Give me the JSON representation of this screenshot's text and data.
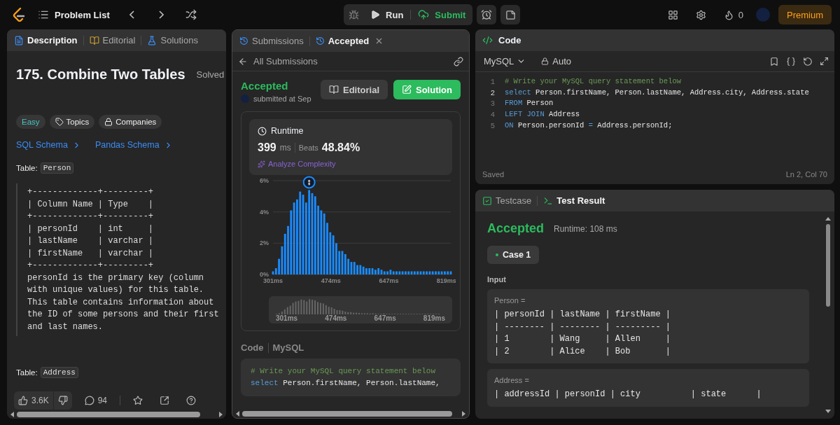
{
  "top_bar": {
    "problem_list": "Problem List",
    "run": "Run",
    "submit": "Submit",
    "streak": "0",
    "premium": "Premium"
  },
  "description_panel": {
    "tabs": [
      {
        "label": "Description",
        "kind": "description",
        "selected": true
      },
      {
        "label": "Editorial",
        "kind": "editorial",
        "selected": false
      },
      {
        "label": "Solutions",
        "kind": "solutions",
        "selected": false
      }
    ],
    "title": "175. Combine Two Tables",
    "status": "Solved",
    "tags": [
      {
        "label": "Easy",
        "kind": "difficulty"
      },
      {
        "label": "Topics",
        "kind": "topics"
      },
      {
        "label": "Companies",
        "kind": "companies"
      }
    ],
    "links": [
      "SQL Schema",
      "Pandas Schema"
    ],
    "tables": [
      {
        "prefix": "Table:",
        "name": "Person",
        "schema": "+-------------+---------+\n| Column Name | Type    |\n+-------------+---------+\n| personId    | int     |\n| lastName    | varchar |\n| firstName   | varchar |\n+-------------+---------+\npersonId is the primary key (column\nwith unique values) for this table.\nThis table contains information about\nthe ID of some persons and their first\nand last names."
      },
      {
        "prefix": "Table:",
        "name": "Address"
      }
    ],
    "footer": {
      "likes": "3.6K",
      "comments": "94"
    }
  },
  "submission_panel": {
    "tabs": [
      {
        "label": "Submissions",
        "selected": false,
        "closable": false
      },
      {
        "label": "Accepted",
        "selected": true,
        "closable": true
      }
    ],
    "back": "All Submissions",
    "status": "Accepted",
    "submitted": "submitted at Sep",
    "buttons": [
      {
        "label": "Editorial",
        "kind": "secondary"
      },
      {
        "label": "Solution",
        "kind": "primary"
      }
    ],
    "runtime": {
      "title": "Runtime",
      "value": "399",
      "unit": "ms",
      "beats_label": "Beats",
      "beats": "48.84%",
      "analyze": "Analyze Complexity"
    },
    "chart_data": {
      "type": "bar",
      "xlim": [
        301,
        832
      ],
      "ylim": [
        0,
        6
      ],
      "x": [
        301,
        310,
        319,
        328,
        337,
        346,
        355,
        364,
        373,
        382,
        391,
        400,
        409,
        418,
        427,
        436,
        445,
        454,
        463,
        472,
        481,
        490,
        499,
        508,
        517,
        526,
        535,
        544,
        553,
        562,
        571,
        580,
        589,
        598,
        607,
        616,
        625,
        634,
        643,
        652,
        661,
        670,
        679,
        688,
        697,
        706,
        715,
        724,
        733,
        742,
        751,
        760,
        769,
        778,
        787,
        796,
        805,
        814,
        823,
        832
      ],
      "series": [
        {
          "color": "#1a8cff",
          "values": [
            0.2,
            0.4,
            1.0,
            1.8,
            2.6,
            3.1,
            4.1,
            4.6,
            4.8,
            5.3,
            5.1,
            4.6,
            5.4,
            5.2,
            5.0,
            4.4,
            4.1,
            3.9,
            3.3,
            2.7,
            2.5,
            2.0,
            1.5,
            1.5,
            1.3,
            1.0,
            0.8,
            0.8,
            0.6,
            0.6,
            0.5,
            0.4,
            0.4,
            0.4,
            0.3,
            0.4,
            0.3,
            0.2,
            0.2,
            0.3,
            0.2,
            0.2,
            0.2,
            0.2,
            0.2,
            0.2,
            0.2,
            0.2,
            0.2,
            0.2,
            0.2,
            0.2,
            0.2,
            0.2,
            0.2,
            0.2,
            0.2,
            0.2,
            0.2,
            0.2
          ]
        }
      ],
      "yticks": [
        {
          "value": 0,
          "label": "0%"
        },
        {
          "value": 2,
          "label": "2%"
        },
        {
          "value": 4,
          "label": "4%"
        },
        {
          "value": 6,
          "label": "6%"
        }
      ],
      "xticks": [
        {
          "value": 301,
          "label": "301ms"
        },
        {
          "value": 474,
          "label": "474ms"
        },
        {
          "value": 647,
          "label": "647ms"
        },
        {
          "value": 819,
          "label": "819ms"
        }
      ]
    },
    "overview_labels": [
      "301ms",
      "474ms",
      "647ms",
      "819ms"
    ],
    "code_label": "Code",
    "language": "MySQL",
    "code_lines": [
      [
        {
          "text": "# Write your MySQL query statement below",
          "kind": "comment"
        }
      ],
      [
        {
          "text": "select",
          "kind": "keyword"
        },
        {
          "text": " Person.firstName, Person.lastName,",
          "kind": "plain"
        }
      ]
    ]
  },
  "code_panel": {
    "title": "Code",
    "language": "MySQL",
    "mode": "Auto",
    "lines": [
      {
        "number": "1",
        "active": false,
        "tokens": [
          {
            "text": "# Write your MySQL query statement below",
            "kind": "comment"
          }
        ]
      },
      {
        "number": "2",
        "active": true,
        "tokens": [
          {
            "text": "select",
            "kind": "keyword"
          },
          {
            "text": " Person.firstName, Person.lastName, Address.city, Address.state",
            "kind": "plain"
          }
        ]
      },
      {
        "number": "3",
        "active": false,
        "tokens": [
          {
            "text": "FROM",
            "kind": "keyword"
          },
          {
            "text": " Person",
            "kind": "plain"
          }
        ]
      },
      {
        "number": "4",
        "active": false,
        "tokens": [
          {
            "text": "LEFT JOIN",
            "kind": "keyword"
          },
          {
            "text": " Address",
            "kind": "plain"
          }
        ]
      },
      {
        "number": "5",
        "active": false,
        "tokens": [
          {
            "text": "ON",
            "kind": "keyword"
          },
          {
            "text": " Person.personId ",
            "kind": "plain"
          },
          {
            "text": "=",
            "kind": "operator"
          },
          {
            "text": " Address.personId;",
            "kind": "plain"
          }
        ]
      }
    ],
    "saved": "Saved",
    "cursor": "Ln 2, Col 70"
  },
  "test_panel": {
    "tabs": [
      {
        "label": "Testcase",
        "kind": "testcase",
        "selected": false
      },
      {
        "label": "Test Result",
        "kind": "result",
        "selected": true
      }
    ],
    "status": "Accepted",
    "runtime": "Runtime: 108 ms",
    "cases": [
      {
        "label": "Case 1",
        "selected": true,
        "passed": true
      }
    ],
    "input_label": "Input",
    "inputs": [
      {
        "name": "Person =",
        "lines": [
          "| personId | lastName | firstName |",
          "| -------- | -------- | --------- |",
          "| 1        | Wang     | Allen     |",
          "| 2        | Alice    | Bob       |"
        ]
      },
      {
        "name": "Address =",
        "lines": [
          "| addressId | personId | city          | state      |"
        ]
      }
    ]
  }
}
